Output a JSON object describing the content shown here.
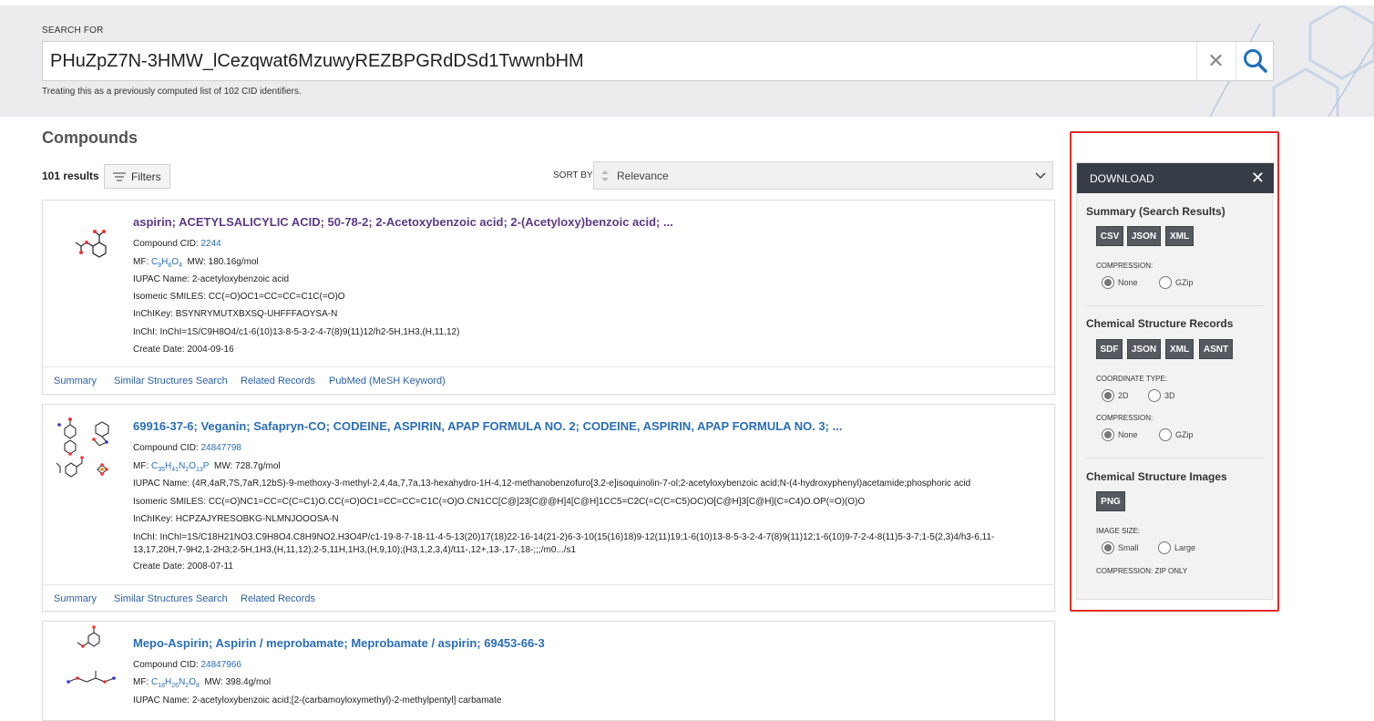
{
  "search": {
    "label": "SEARCH FOR",
    "query": "PHuZpZ7N-3HMW_lCezqwat6MzuwyREZBPGRdDSd1TwwnbHM",
    "clear_icon": "close-icon",
    "search_icon": "search-icon",
    "note": "Treating this as a previously computed list of 102 CID identifiers."
  },
  "results": {
    "heading": "Compounds",
    "count": "101 results",
    "filters_label": "Filters",
    "sort_label": "SORT BY",
    "sort_value": "Relevance"
  },
  "compounds": [
    {
      "title": "aspirin; ACETYLSALICYLIC ACID; 50-78-2; 2-Acetoxybenzoic acid; 2-(Acetyloxy)benzoic acid; ...",
      "cid_label": "Compound CID:",
      "cid": "2244",
      "mf_label": "MF:",
      "mf": [
        "C",
        "9",
        "H",
        "8",
        "O",
        "4"
      ],
      "mw": "MW: 180.16g/mol",
      "iupac_label": "IUPAC Name:",
      "iupac": "2-acetyloxybenzoic acid",
      "smiles_label": "Isomeric SMILES:",
      "smiles": "CC(=O)OC1=CC=CC=C1C(=O)O",
      "inchikey_label": "InChIKey:",
      "inchikey": "BSYNRYMUTXBXSQ-UHFFFAOYSA-N",
      "inchi_label": "InChI:",
      "inchi": "InChI=1S/C9H8O4/c1-6(10)13-8-5-3-2-4-7(8)9(11)12/h2-5H,1H3,(H,11,12)",
      "date_label": "Create Date:",
      "date": "2004-09-16",
      "links": [
        "Summary",
        "Similar Structures Search",
        "Related Records",
        "PubMed (MeSH Keyword)"
      ]
    },
    {
      "title": "69916-37-6; Veganin; Safapryn-CO; CODEINE, ASPIRIN, APAP FORMULA NO. 2; CODEINE, ASPIRIN, APAP FORMULA NO. 3; ...",
      "cid_label": "Compound CID:",
      "cid": "24847798",
      "mf_label": "MF:",
      "mf": [
        "C",
        "35",
        "H",
        "41",
        "N",
        "2",
        "O",
        "13",
        "P",
        ""
      ],
      "mw": "MW: 728.7g/mol",
      "iupac_label": "IUPAC Name:",
      "iupac": "(4R,4aR,7S,7aR,12bS)-9-methoxy-3-methyl-2,4,4a,7,7a,13-hexahydro-1H-4,12-methanobenzofuro[3,2-e]isoquinolin-7-ol;2-acetyloxybenzoic acid;N-(4-hydroxyphenyl)acetamide;phosphoric acid",
      "smiles_label": "Isomeric SMILES:",
      "smiles": "CC(=O)NC1=CC=C(C=C1)O.CC(=O)OC1=CC=CC=C1C(=O)O.CN1CC[C@]23[C@@H]4[C@H]1CC5=C2C(=C(C=C5)OC)O[C@H]3[C@H](C=C4)O.OP(=O)(O)O",
      "inchikey_label": "InChIKey:",
      "inchikey": "HCPZAJYRESOBKG-NLMNJOOOSA-N",
      "inchi_label": "InChI:",
      "inchi": "InChI=1S/C18H21NO3.C9H8O4.C8H9NO2.H3O4P/c1-19-8-7-18-11-4-5-13(20)17(18)22-16-14(21-2)6-3-10(15(16)18)9-12(11)19;1-6(10)13-8-5-3-2-4-7(8)9(11)12;1-6(10)9-7-2-4-8(11)5-3-7;1-5(2,3)4/h3-6,11-",
      "inchi2": "13,17,20H,7-9H2,1-2H3;2-5H,1H3,(H,11,12);2-5,11H,1H3,(H,9,10);(H3,1,2,3,4)/t11-,12+,13-,17-,18-;;;/m0.../s1",
      "date_label": "Create Date:",
      "date": "2008-07-11",
      "links": [
        "Summary",
        "Similar Structures Search",
        "Related Records"
      ]
    },
    {
      "title": "Mepo-Aspirin; Aspirin / meprobamate; Meprobamate / aspirin; 69453-66-3",
      "cid_label": "Compound CID:",
      "cid": "24847966",
      "mf_label": "MF:",
      "mf": [
        "C",
        "18",
        "H",
        "26",
        "N",
        "2",
        "O",
        "8"
      ],
      "mw": "MW: 398.4g/mol",
      "iupac_label": "IUPAC Name:",
      "iupac": "2-acetyloxybenzoic acid;[2-(carbamoyloxymethyl)-2-methylpentyl] carbamate"
    }
  ],
  "download": {
    "title": "DOWNLOAD",
    "close_icon": "close-icon",
    "summary_title": "Summary (Search Results)",
    "summary_formats": [
      "CSV",
      "JSON",
      "XML"
    ],
    "compression_label": "COMPRESSION:",
    "opt_none": "None",
    "opt_gzip": "GZip",
    "records_title": "Chemical Structure Records",
    "records_formats": [
      "SDF",
      "JSON",
      "XML",
      "ASNT"
    ],
    "coord_label": "COORDINATE TYPE:",
    "opt_2d": "2D",
    "opt_3d": "3D",
    "images_title": "Chemical Structure Images",
    "images_formats": [
      "PNG"
    ],
    "size_label": "IMAGE SIZE:",
    "opt_small": "Small",
    "opt_large": "Large",
    "zip_note": "COMPRESSION: ZIP ONLY"
  },
  "colors": {
    "link": "#2a6eb8",
    "visited": "#5d3a86",
    "panel_header": "#373d46",
    "highlight": "#e22b2b"
  }
}
